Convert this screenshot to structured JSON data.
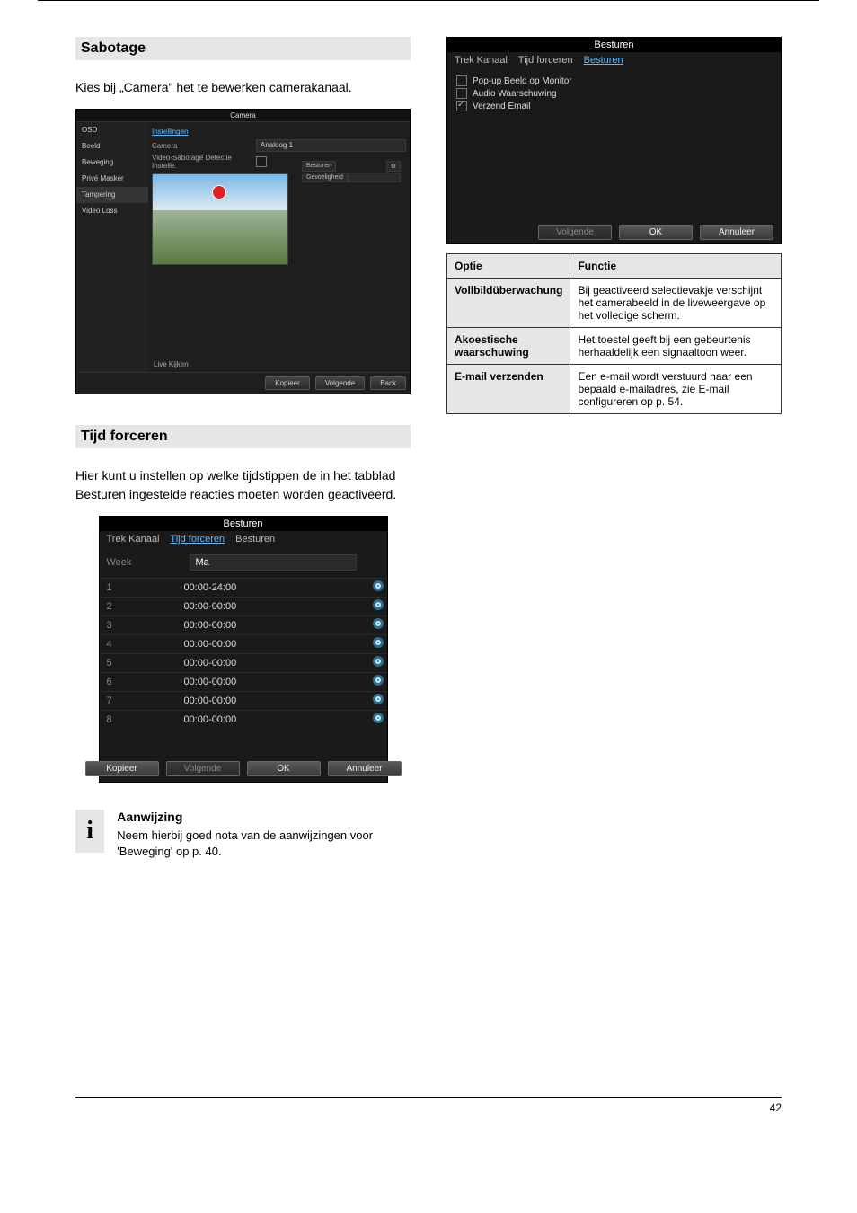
{
  "sections": {
    "tampering_title": "Sabotage",
    "schedule_title": "Tijd forceren"
  },
  "intro_text": "Kies bij „Camera\" het te bewerken camerakanaal.",
  "schedule_intro": "Hier kunt u instellen op welke tijdstippen de in het tabblad Besturen ingestelde reacties moeten worden geactiveerd.",
  "camera_panel": {
    "title": "Camera",
    "side_items": [
      "OSD",
      "Beeld",
      "Beweging",
      "Privé Masker",
      "Tampering",
      "Video Loss"
    ],
    "selected_item": "Tampering",
    "link_label": "Instellingen",
    "row_camera_label": "Camera",
    "row_camera_value": "Analoog 1",
    "row_tamp_label": "Video-Sabotage Detectie Instelle.",
    "right_labels": {
      "besturen": "Besturen",
      "gevoel": "Gevoeligheid"
    },
    "live_view": "Live Kijken",
    "buttons": {
      "kopieer": "Kopieer",
      "volgende": "Volgende",
      "back": "Back"
    }
  },
  "besturen_dialog": {
    "title": "Besturen",
    "tabs": {
      "trek": "Trek Kanaal",
      "tijd": "Tijd forceren",
      "besturen": "Besturen"
    },
    "active_tab": "besturen",
    "checkboxes": [
      {
        "label": "Pop-up Beeld op Monitor",
        "checked": false
      },
      {
        "label": "Audio Waarschuwing",
        "checked": false
      },
      {
        "label": "Verzend Email",
        "checked": true
      }
    ],
    "buttons": {
      "volgende": "Volgende",
      "ok": "OK",
      "annuleer": "Annuleer"
    }
  },
  "option_table": {
    "header": {
      "opt": "Optie",
      "func": "Functie"
    },
    "rows": [
      {
        "opt": "Vollbildüberwachung",
        "func": "Bij geactiveerd selectievakje verschijnt het camerabeeld in de liveweergave op het volledige scherm."
      },
      {
        "opt": "Akoestische waarschuwing",
        "func": "Het toestel geeft bij een gebeurtenis herhaaldelijk een signaaltoon weer."
      },
      {
        "opt": "E-mail verzenden",
        "func": "Een e-mail wordt verstuurd naar een bepaald e-mailadres, zie E-mail configureren op p. 54."
      }
    ]
  },
  "schedule_dialog": {
    "title": "Besturen",
    "tabs": {
      "trek": "Trek Kanaal",
      "tijd": "Tijd forceren",
      "besturen": "Besturen"
    },
    "week_label": "Week",
    "week_value": "Ma",
    "rows": [
      {
        "n": "1",
        "t": "00:00-24:00"
      },
      {
        "n": "2",
        "t": "00:00-00:00"
      },
      {
        "n": "3",
        "t": "00:00-00:00"
      },
      {
        "n": "4",
        "t": "00:00-00:00"
      },
      {
        "n": "5",
        "t": "00:00-00:00"
      },
      {
        "n": "6",
        "t": "00:00-00:00"
      },
      {
        "n": "7",
        "t": "00:00-00:00"
      },
      {
        "n": "8",
        "t": "00:00-00:00"
      }
    ],
    "buttons": {
      "kopieer": "Kopieer",
      "volgende": "Volgende",
      "ok": "OK",
      "annuleer": "Annuleer"
    }
  },
  "note": {
    "title": "Aanwijzing",
    "text": "Neem hierbij goed nota van de aanwijzingen voor 'Beweging' op p. 40."
  },
  "page_number": "42"
}
